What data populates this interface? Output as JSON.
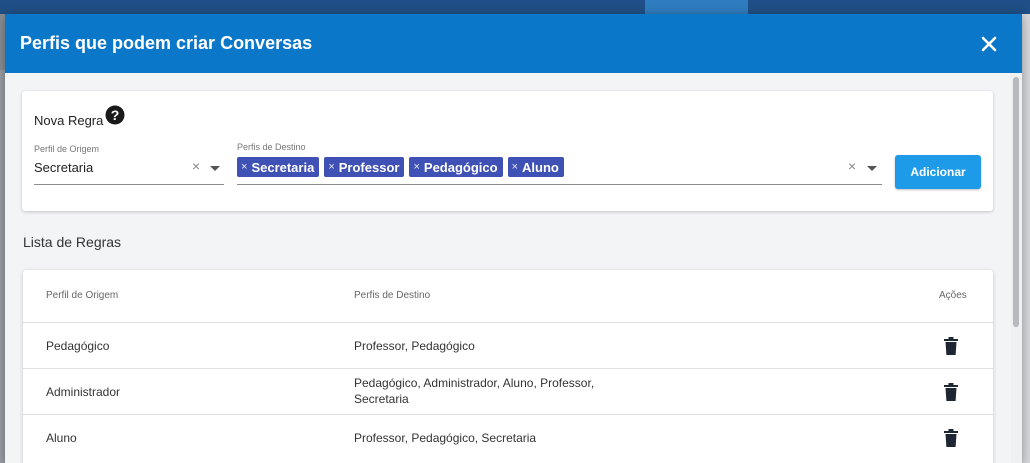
{
  "modal": {
    "title": "Perfis que podem criar Conversas",
    "close_icon": "close-icon"
  },
  "form": {
    "section_title": "Nova Regra",
    "help_icon": "question-circle-icon",
    "origem": {
      "label": "Perfil de Origem",
      "value": "Secretaria"
    },
    "destino": {
      "label": "Perfis de Destino",
      "chips": [
        "Secretaria",
        "Professor",
        "Pedagógico",
        "Aluno"
      ]
    },
    "chip_remove_glyph": "×",
    "clear_glyph": "×",
    "add_button": "Adicionar"
  },
  "list": {
    "title": "Lista de Regras",
    "columns": {
      "origem": "Perfil de Origem",
      "destino": "Perfis de Destino",
      "acoes": "Ações"
    },
    "rows": [
      {
        "origem": "Pedagógico",
        "destino": "Professor, Pedagógico"
      },
      {
        "origem": "Administrador",
        "destino_line1": "Pedagógico, Administrador, Aluno, Professor,",
        "destino_line2": "Secretaria"
      },
      {
        "origem": "Aluno",
        "destino": "Professor, Pedagógico, Secretaria"
      }
    ],
    "delete_icon": "trash-icon"
  },
  "colors": {
    "header": "#0a77c9",
    "chip": "#3f51b5",
    "button": "#1e9be8"
  }
}
